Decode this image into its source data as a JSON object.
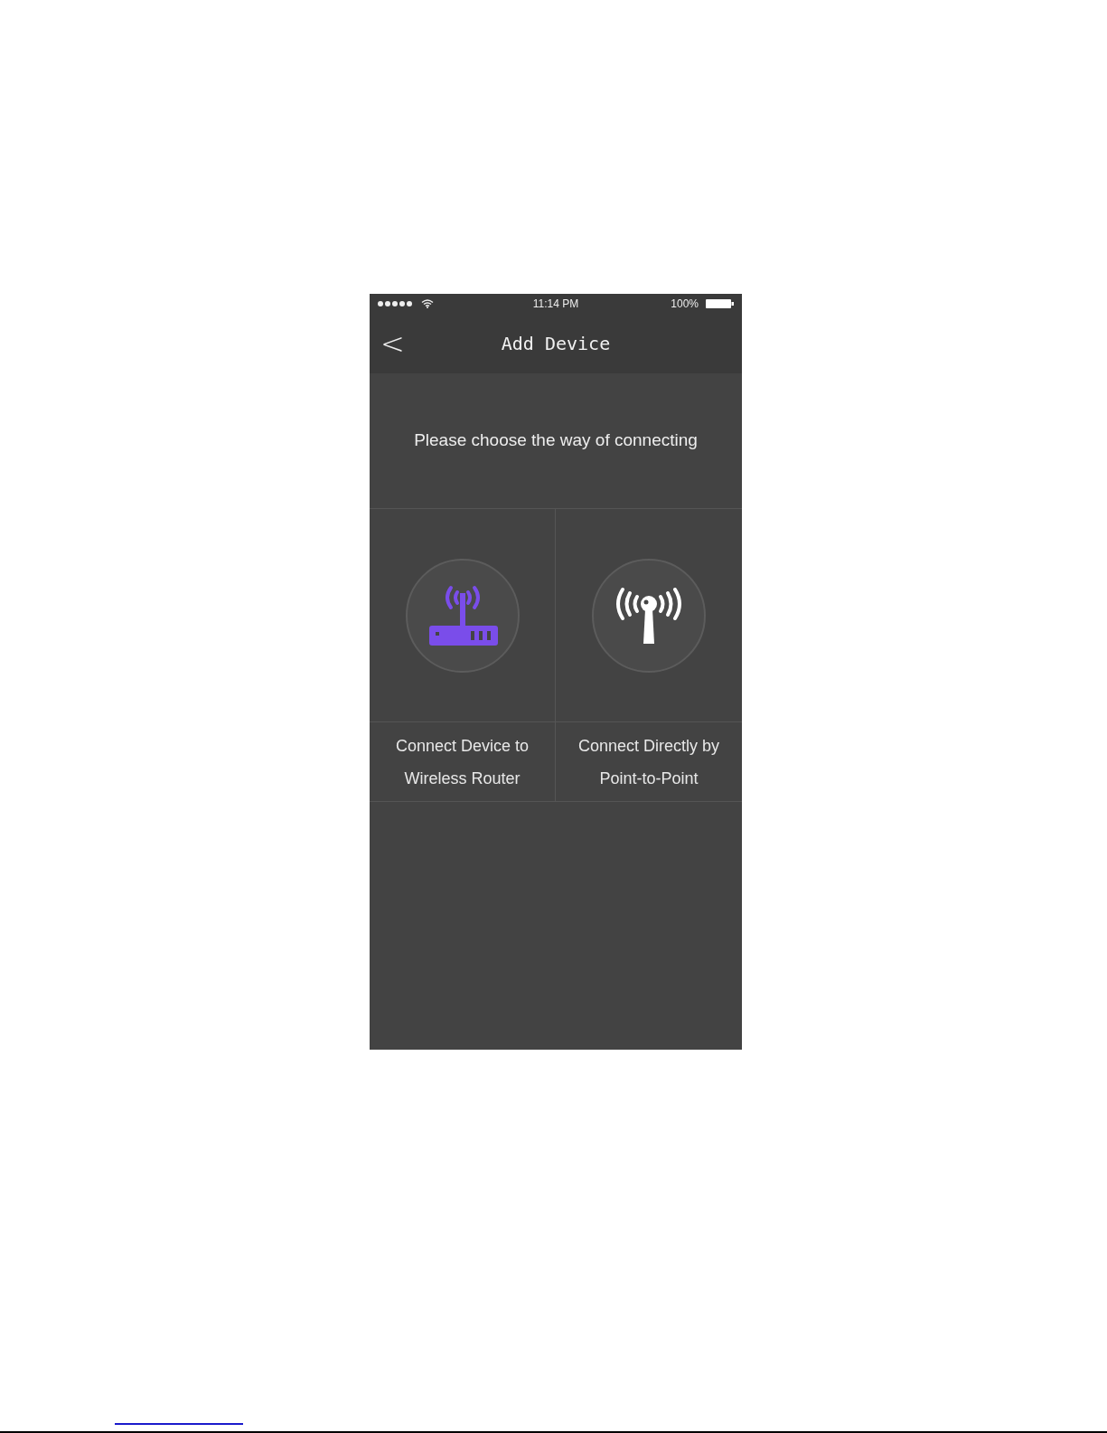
{
  "status_bar": {
    "time": "11:14 PM",
    "battery": "100%"
  },
  "nav_bar": {
    "back": "<",
    "title": "Add Device"
  },
  "prompt": "Please choose the way of connecting",
  "options": [
    {
      "kind": "router",
      "label": [
        "Connect Device to",
        "Wireless Router"
      ],
      "selected": true
    },
    {
      "kind": "antenna",
      "label": [
        "Connect Directly by",
        "Point-to-Point"
      ],
      "selected": false
    }
  ]
}
